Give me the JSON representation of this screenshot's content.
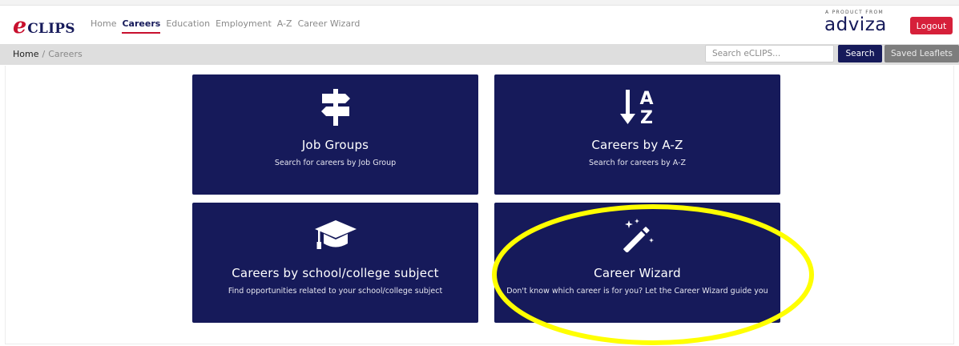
{
  "navbar": {
    "logo_e": "e",
    "logo_clips": "CLIPS",
    "links": [
      {
        "label": "Home",
        "active": false
      },
      {
        "label": "Careers",
        "active": true
      },
      {
        "label": "Education",
        "active": false
      },
      {
        "label": "Employment",
        "active": false
      },
      {
        "label": "A-Z",
        "active": false
      },
      {
        "label": "Career Wizard",
        "active": false
      }
    ],
    "brand_small": "A PRODUCT FROM",
    "brand_name": "adviza",
    "logout_label": "Logout"
  },
  "breadcrumb": {
    "home": "Home",
    "separator": "/",
    "current": "Careers"
  },
  "search": {
    "placeholder": "Search eCLIPS...",
    "button_label": "Search",
    "saved_label": "Saved Leaflets"
  },
  "tiles": [
    {
      "icon": "signpost-icon",
      "title": "Job Groups",
      "subtitle": "Search for careers by Job Group"
    },
    {
      "icon": "sort-az-icon",
      "title": "Careers by A-Z",
      "subtitle": "Search for careers by A-Z"
    },
    {
      "icon": "graduation-cap-icon",
      "title": "Careers by school/college subject",
      "subtitle": "Find opportunities related to your school/college subject"
    },
    {
      "icon": "magic-wand-icon",
      "title": "Career Wizard",
      "subtitle": "Don't know which career is for you? Let the Career Wizard guide you"
    }
  ],
  "colors": {
    "navy": "#161a5a",
    "red": "#d6203a",
    "highlight": "#ffff00"
  }
}
